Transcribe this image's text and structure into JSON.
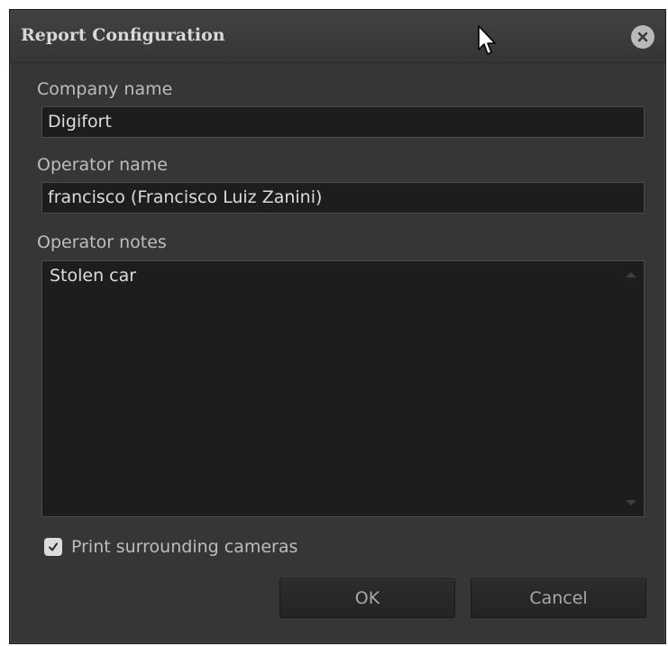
{
  "dialog": {
    "title": "Report Configuration",
    "close_icon": "close-icon"
  },
  "fields": {
    "company_label": "Company name",
    "company_value": "Digifort",
    "operator_label": "Operator name",
    "operator_value": "francisco (Francisco Luiz Zanini)",
    "notes_label": "Operator notes",
    "notes_value": "Stolen car"
  },
  "options": {
    "print_cameras_label": "Print surrounding cameras",
    "print_cameras_checked": true
  },
  "buttons": {
    "ok_label": "OK",
    "cancel_label": "Cancel"
  },
  "colors": {
    "dialog_bg": "#363636",
    "input_bg": "#1d1d1d",
    "text": "#bdbdbd"
  }
}
